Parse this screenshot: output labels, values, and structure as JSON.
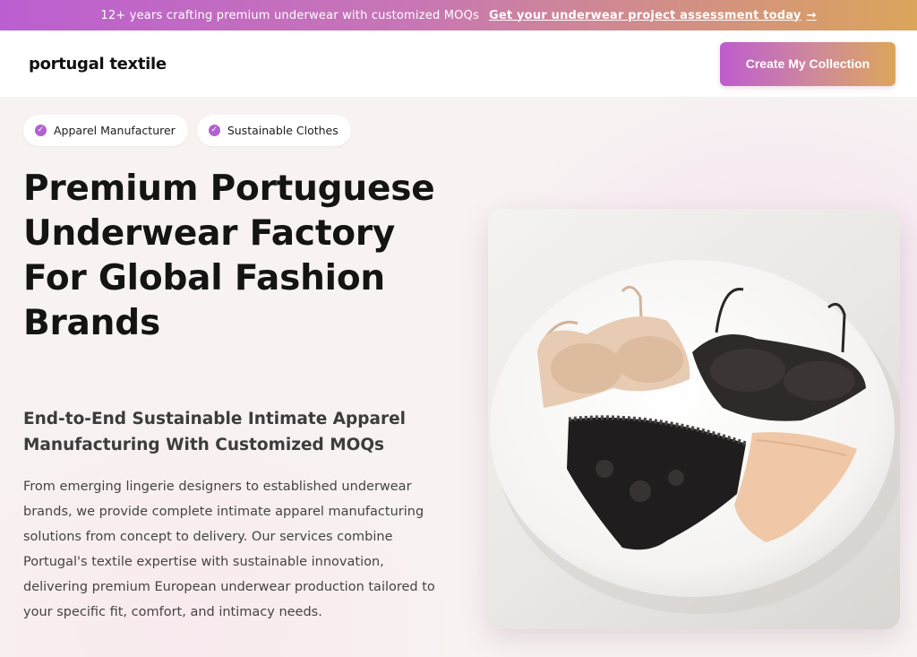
{
  "announcement": {
    "message": "12+ years crafting premium underwear with customized MOQs",
    "link_label": "Get your underwear project assessment today",
    "arrow": "→"
  },
  "header": {
    "logo": "portugal textile",
    "cta_label": "Create My Collection"
  },
  "badges": [
    {
      "label": "Apparel Manufacturer",
      "icon": "check-circle-icon"
    },
    {
      "label": "Sustainable Clothes",
      "icon": "check-circle-icon"
    }
  ],
  "hero": {
    "title": "Premium Portuguese Underwear Factory For Global Fashion Brands",
    "subtitle": "End-to-End Sustainable Intimate Apparel Manufacturing With Customized MOQs",
    "description": "From emerging lingerie designers to established underwear brands, we provide complete intimate apparel manufacturing solutions from concept to delivery. Our services combine Portugal's textile expertise with sustainable innovation, delivering premium European underwear production tailored to your specific fit, comfort, and intimacy needs."
  },
  "colors": {
    "accent_purple": "#b460d0",
    "accent_gold": "#dca65a",
    "text_dark": "#141414"
  }
}
